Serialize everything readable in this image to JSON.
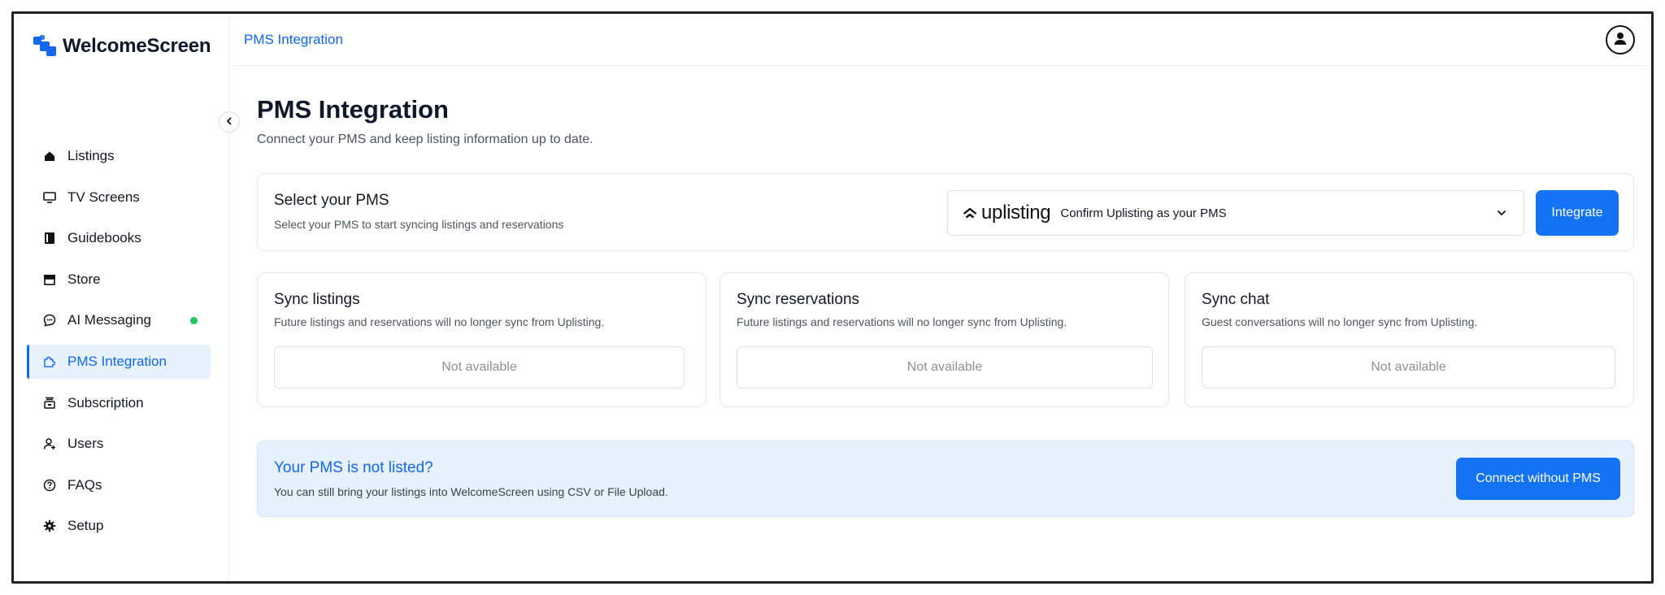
{
  "app": {
    "name": "WelcomeScreen",
    "accent": "#1167f2"
  },
  "breadcrumb": "PMS Integration",
  "sidebar": {
    "items": [
      {
        "label": "Listings",
        "icon": "home-icon"
      },
      {
        "label": "TV Screens",
        "icon": "monitor-icon"
      },
      {
        "label": "Guidebooks",
        "icon": "book-icon"
      },
      {
        "label": "Store",
        "icon": "store-icon"
      },
      {
        "label": "AI Messaging",
        "icon": "chat-icon",
        "status": "online"
      },
      {
        "label": "PMS Integration",
        "icon": "puzzle-icon",
        "active": true
      },
      {
        "label": "Subscription",
        "icon": "subscription-icon"
      },
      {
        "label": "Users",
        "icon": "add-user-icon"
      },
      {
        "label": "FAQs",
        "icon": "help-icon"
      },
      {
        "label": "Setup",
        "icon": "gear-icon"
      }
    ]
  },
  "page": {
    "title": "PMS Integration",
    "subtitle": "Connect your PMS and keep listing information up to date."
  },
  "pms": {
    "heading": "Select your PMS",
    "description": "Select your PMS to start syncing listings and reservations",
    "selected_logo": "uplisting",
    "selected_text": "Confirm Uplisting as your PMS",
    "integrate_label": "Integrate"
  },
  "sync_cards": [
    {
      "title": "Sync listings",
      "description": "Future listings and reservations will no longer sync from Uplisting.",
      "status": "Not available"
    },
    {
      "title": "Sync reservations",
      "description": "Future listings and reservations will no longer sync from Uplisting.",
      "status": "Not available"
    },
    {
      "title": "Sync chat",
      "description": "Guest conversations will no longer sync from Uplisting.",
      "status": "Not available"
    }
  ],
  "banner": {
    "heading": "Your PMS is not listed?",
    "description": "You can still bring your listings into WelcomeScreen using CSV or File Upload.",
    "button_label": "Connect without PMS"
  }
}
